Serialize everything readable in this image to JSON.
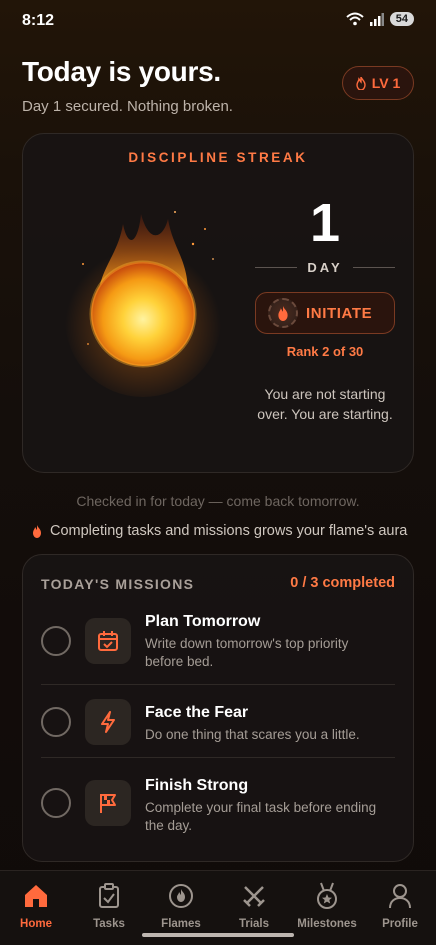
{
  "status_bar": {
    "time": "8:12",
    "battery": "54"
  },
  "header": {
    "title": "Today is yours.",
    "subtitle": "Day 1 secured. Nothing broken.",
    "level": "LV 1"
  },
  "streak": {
    "label": "DISCIPLINE STREAK",
    "count": "1",
    "unit": "DAY",
    "rank_name": "INITIATE",
    "rank_position": "Rank 2 of 30",
    "message": "You are not starting over. You are starting."
  },
  "checkin_text": "Checked in for today — come back tomorrow.",
  "aura_text": "Completing tasks and missions grows your flame's aura",
  "missions": {
    "heading": "TODAY'S MISSIONS",
    "completed_text": "0 / 3 completed",
    "items": [
      {
        "title": "Plan Tomorrow",
        "description": "Write down tomorrow's top priority before bed.",
        "icon": "calendar-check-icon",
        "done": false
      },
      {
        "title": "Face the Fear",
        "description": "Do one thing that scares you a little.",
        "icon": "lightning-icon",
        "done": false
      },
      {
        "title": "Finish Strong",
        "description": "Complete your final task before ending the day.",
        "icon": "checkered-flag-icon",
        "done": false
      }
    ]
  },
  "nav": {
    "active": "Home",
    "items": [
      {
        "label": "Home",
        "icon": "home-icon"
      },
      {
        "label": "Tasks",
        "icon": "clipboard-check-icon"
      },
      {
        "label": "Flames",
        "icon": "flame-icon"
      },
      {
        "label": "Trials",
        "icon": "crossed-swords-icon"
      },
      {
        "label": "Milestones",
        "icon": "medal-icon"
      },
      {
        "label": "Profile",
        "icon": "person-icon"
      }
    ]
  },
  "colors": {
    "accent": "#ff6a3d",
    "card": "#181413",
    "background": "#120c0a"
  }
}
